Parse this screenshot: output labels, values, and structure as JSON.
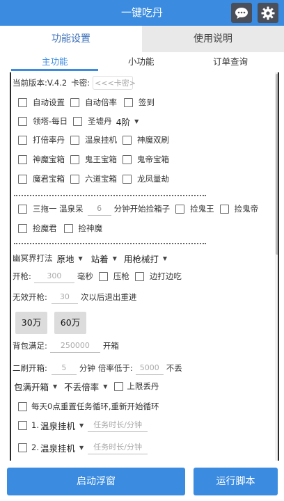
{
  "header": {
    "title": "一键吃丹",
    "chat_icon": "chat-bubble-icon",
    "settings_icon": "gear-icon"
  },
  "top_tabs": [
    {
      "label": "功能设置",
      "active": true
    },
    {
      "label": "使用说明",
      "active": false
    }
  ],
  "sub_tabs": [
    {
      "label": "主功能",
      "active": true
    },
    {
      "label": "小功能",
      "active": false
    },
    {
      "label": "订单查询",
      "active": false
    }
  ],
  "version": {
    "text": "当前版本:V.4.2",
    "card_label": "卡密:",
    "card_placeholder": "<<<卡密>"
  },
  "features": {
    "auto_setting": "自动设置",
    "auto_multiplier": "自动倍率",
    "sign_in": "签到",
    "tower_daily": "领塔-每日",
    "holy_furnace": "圣墟丹",
    "holy_furnace_level": "4阶",
    "multiplier_pill": "打倍率丹",
    "hot_spring": "温泉挂机",
    "god_demon_double": "神魔双刷",
    "god_demon_chest": "神魔宝箱",
    "ghost_king_chest": "鬼王宝箱",
    "ghost_emperor_chest": "鬼帝宝箱",
    "demon_lord_chest": "魔君宝箱",
    "six_path_chest": "六道宝箱",
    "dragon_phoenix": "龙凤量劫"
  },
  "pickup": {
    "pre": "三拖一 温泉呆",
    "minutes": "6",
    "post": "分钟开始捡箱子",
    "ghost_king": "捡鬼王",
    "ghost_emperor": "捡鬼帝",
    "demon_lord": "捡魔君",
    "god_demon": "捡神魔"
  },
  "netherworld": {
    "label": "幽冥界打法",
    "position": "原地",
    "stance": "站着",
    "attack": "用枪械打",
    "fire_label": "开枪:",
    "fire_ms": "300",
    "ms_unit": "毫秒",
    "press_gun": "压枪",
    "move_shoot": "边打边吃"
  },
  "invalid": {
    "label": "无效开枪:",
    "count": "30",
    "suffix": "次以后退出重进"
  },
  "amount_buttons": [
    "30万",
    "60万"
  ],
  "bag": {
    "label": "背包满足:",
    "value": "250000",
    "suffix": "开箱"
  },
  "second": {
    "label": "二刷开箱:",
    "minutes": "5",
    "min_unit": "分钟",
    "rate_label": "倍率低于:",
    "rate": "5000",
    "suffix": "不丢"
  },
  "options": {
    "full_open": "包满开箱",
    "keep_rate": "不丢倍率",
    "upper_limit_drop": "上限丢丹",
    "daily_reset": "每天0点重置任务循环,重新开始循环"
  },
  "tasks": [
    {
      "index": "1.",
      "name": "温泉挂机",
      "placeholder": "任务时长/分钟"
    },
    {
      "index": "2.",
      "name": "温泉挂机",
      "placeholder": "任务时长/分钟"
    }
  ],
  "bottom": {
    "float_button": "启动浮窗",
    "run_button": "运行脚本"
  },
  "colors": {
    "primary": "#3b8ce0",
    "header_icon_bg": "#4a4f5a",
    "tab_inactive": "#e9e9e9"
  }
}
